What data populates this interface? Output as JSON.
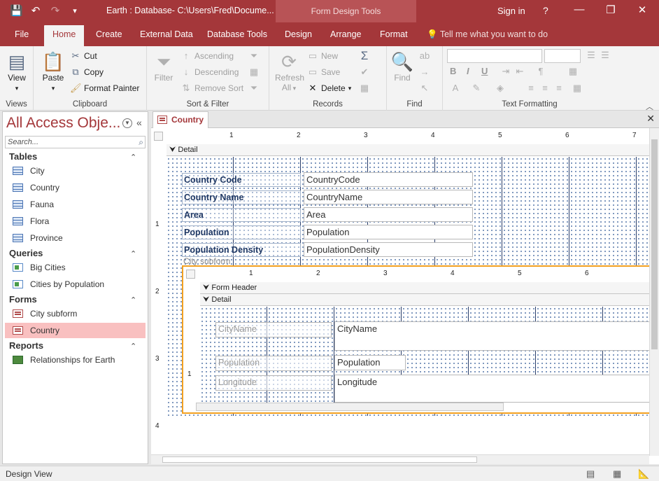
{
  "window": {
    "title": "Earth : Database- C:\\Users\\Fred\\Docume...",
    "context_tab_group": "Form Design Tools",
    "sign_in": "Sign in",
    "help": "?",
    "minimize": "—",
    "restore": "❐",
    "close": "✕"
  },
  "ribbon_tabs": {
    "file": "File",
    "home": "Home",
    "create": "Create",
    "external_data": "External Data",
    "database_tools": "Database Tools",
    "design": "Design",
    "arrange": "Arrange",
    "format": "Format",
    "tell_me": "Tell me what you want to do"
  },
  "ribbon": {
    "views": {
      "view": "View",
      "label": "Views"
    },
    "clipboard": {
      "paste": "Paste",
      "cut": "Cut",
      "copy": "Copy",
      "format_painter": "Format Painter",
      "label": "Clipboard"
    },
    "sort_filter": {
      "filter": "Filter",
      "ascending": "Ascending",
      "descending": "Descending",
      "remove_sort": "Remove Sort",
      "label": "Sort & Filter"
    },
    "records": {
      "refresh": "Refresh",
      "refresh_all": "All",
      "new": "New",
      "save": "Save",
      "delete": "Delete",
      "label": "Records"
    },
    "find": {
      "find": "Find",
      "label": "Find"
    },
    "text_formatting": {
      "label": "Text Formatting",
      "bold": "B",
      "italic": "I",
      "underline": "U"
    }
  },
  "nav": {
    "title": "All Access Obje...",
    "search_placeholder": "Search...",
    "sections": [
      {
        "name": "Tables",
        "items": [
          "City",
          "Country",
          "Fauna",
          "Flora",
          "Province"
        ]
      },
      {
        "name": "Queries",
        "items": [
          "Big Cities",
          "Cities by Population"
        ]
      },
      {
        "name": "Forms",
        "items": [
          "City subform",
          "Country"
        ]
      },
      {
        "name": "Reports",
        "items": [
          "Relationships for Earth"
        ]
      }
    ],
    "selected": "Country"
  },
  "document": {
    "tab": "Country",
    "detail_bar": "Detail",
    "fields": [
      {
        "label": "Country Code",
        "control": "CountryCode"
      },
      {
        "label": "Country Name",
        "control": "CountryName"
      },
      {
        "label": "Area",
        "control": "Area"
      },
      {
        "label": "Population",
        "control": "Population"
      },
      {
        "label": "Population Density",
        "control": "PopulationDensity"
      }
    ],
    "subform_label": "City subform",
    "subform": {
      "form_header_bar": "Form Header",
      "detail_bar": "Detail",
      "fields": [
        {
          "label": "CityName",
          "control": "CityName"
        },
        {
          "label": "Population",
          "control": "Population"
        },
        {
          "label": "Longitude",
          "control": "Longitude"
        }
      ]
    },
    "ruler_numbers": [
      "1",
      "2",
      "3",
      "4",
      "5",
      "6",
      "7"
    ],
    "vruler_numbers": [
      "1",
      "2",
      "3",
      "4"
    ],
    "sub_ruler_numbers": [
      "1",
      "2",
      "3",
      "4",
      "5",
      "6"
    ],
    "sub_vruler_numbers": [
      "1"
    ]
  },
  "status": {
    "text": "Design View"
  }
}
